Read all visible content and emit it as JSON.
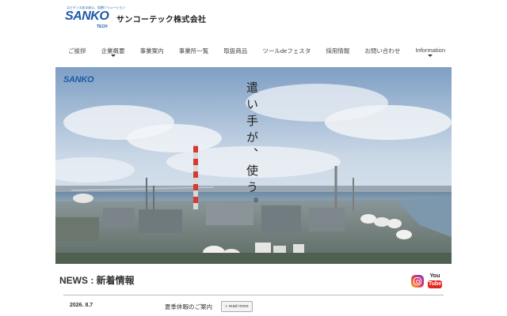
{
  "brand": {
    "tagline": "エビデンスある安心、信頼ソリューション",
    "logo_text": "SANKO",
    "logo_sub": "TECH",
    "company_name": "サンコーテック株式会社"
  },
  "nav": {
    "items": [
      {
        "label": "ご挨拶",
        "has_dropdown": false
      },
      {
        "label": "企業概要",
        "has_dropdown": true
      },
      {
        "label": "事業案内",
        "has_dropdown": false
      },
      {
        "label": "事業所一覧",
        "has_dropdown": false
      },
      {
        "label": "取扱商品",
        "has_dropdown": false
      },
      {
        "label": "ツールdeフェスタ",
        "has_dropdown": false
      },
      {
        "label": "採用情報",
        "has_dropdown": false
      },
      {
        "label": "お問い合わせ",
        "has_dropdown": false
      },
      {
        "label": "Information",
        "has_dropdown": true
      }
    ]
  },
  "hero": {
    "logo_text": "SANKO",
    "catchphrase": "遣い手が、使う。"
  },
  "news": {
    "title": "NEWS : 新着情報",
    "social": [
      {
        "icon": "instagram-icon"
      },
      {
        "icon": "youtube-icon",
        "label_top": "You",
        "label_bottom": "Tube"
      }
    ],
    "items": [
      {
        "date": "2026. 8.7",
        "text": "夏季休暇のご案内",
        "button": "» read more"
      }
    ]
  }
}
